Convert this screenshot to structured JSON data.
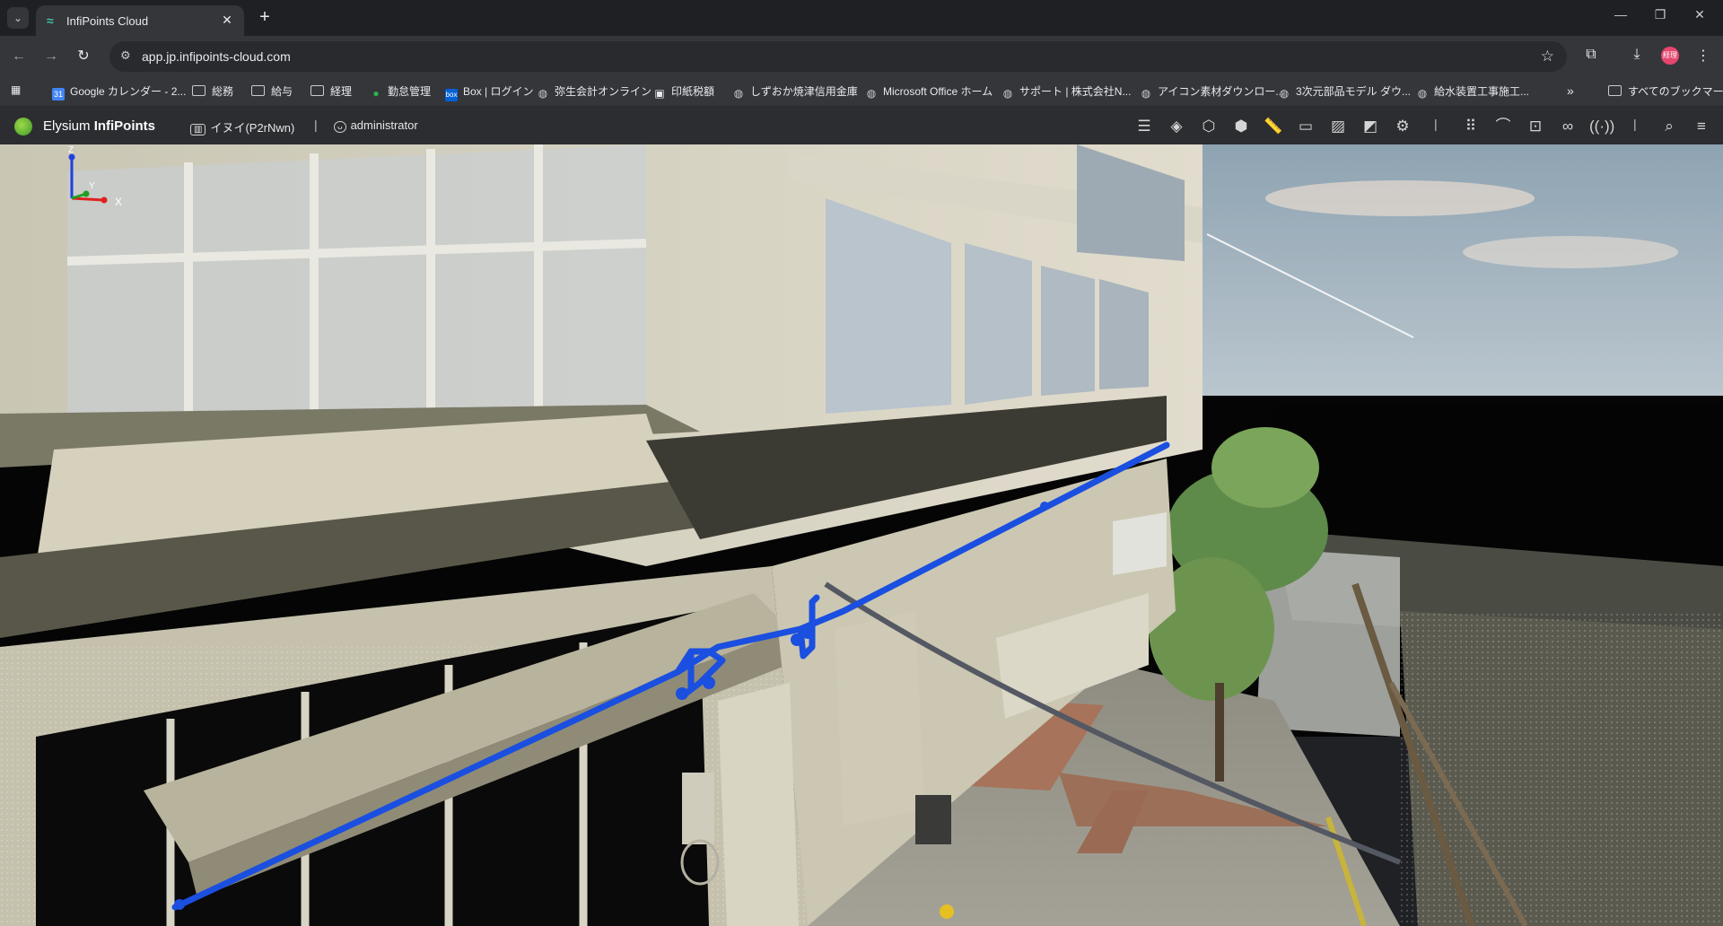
{
  "browser": {
    "tab_title": "InfiPoints Cloud",
    "url": "app.jp.infipoints-cloud.com",
    "profile_label": "経理",
    "bookmarks": [
      {
        "label": "Google カレンダー - 2...",
        "icon": "google-calendar-icon"
      },
      {
        "label": "総務",
        "icon": "folder-icon"
      },
      {
        "label": "給与",
        "icon": "folder-icon"
      },
      {
        "label": "経理",
        "icon": "folder-icon"
      },
      {
        "label": "勤怠管理",
        "icon": "site-icon"
      },
      {
        "label": "Box | ログイン",
        "icon": "box-icon"
      },
      {
        "label": "弥生会計オンライン",
        "icon": "globe-icon"
      },
      {
        "label": "印紙税額",
        "icon": "site-icon"
      },
      {
        "label": "しずおか焼津信用金庫",
        "icon": "globe-icon"
      },
      {
        "label": "Microsoft Office ホーム",
        "icon": "globe-icon"
      },
      {
        "label": "サポート | 株式会社N...",
        "icon": "globe-icon"
      },
      {
        "label": "アイコン素材ダウンロー...",
        "icon": "globe-icon"
      },
      {
        "label": "3次元部品モデル ダウ...",
        "icon": "globe-icon"
      },
      {
        "label": "給水装置工事施工...",
        "icon": "globe-icon"
      }
    ],
    "all_bookmarks": "すべてのブックマーク"
  },
  "app": {
    "brand_prefix": "Elysium",
    "brand_name": "InfiPoints",
    "project": "イヌイ(P2rNwn)",
    "user": "administrator",
    "separator": "|",
    "toolbar_icons": [
      "tree-icon",
      "layers-icon",
      "box-icon",
      "cube-view-icon",
      "measure-ruler-icon",
      "comment-icon",
      "image-icon",
      "section-plane-icon",
      "settings-gear-icon",
      "grid-icon",
      "walkthrough-icon",
      "target-icon",
      "link-icon",
      "broadcast-icon",
      "search-icon",
      "menu-icon"
    ]
  },
  "viewport": {
    "axis_labels": {
      "x": "X",
      "y": "Y",
      "z": "Z"
    },
    "colors": {
      "pipe": "#1a4fe0",
      "sky_top": "#8ea3b2",
      "sky_bottom": "#d7dde0",
      "axis_x": "#e02020",
      "axis_y": "#20a020",
      "axis_z": "#2040e0"
    }
  }
}
